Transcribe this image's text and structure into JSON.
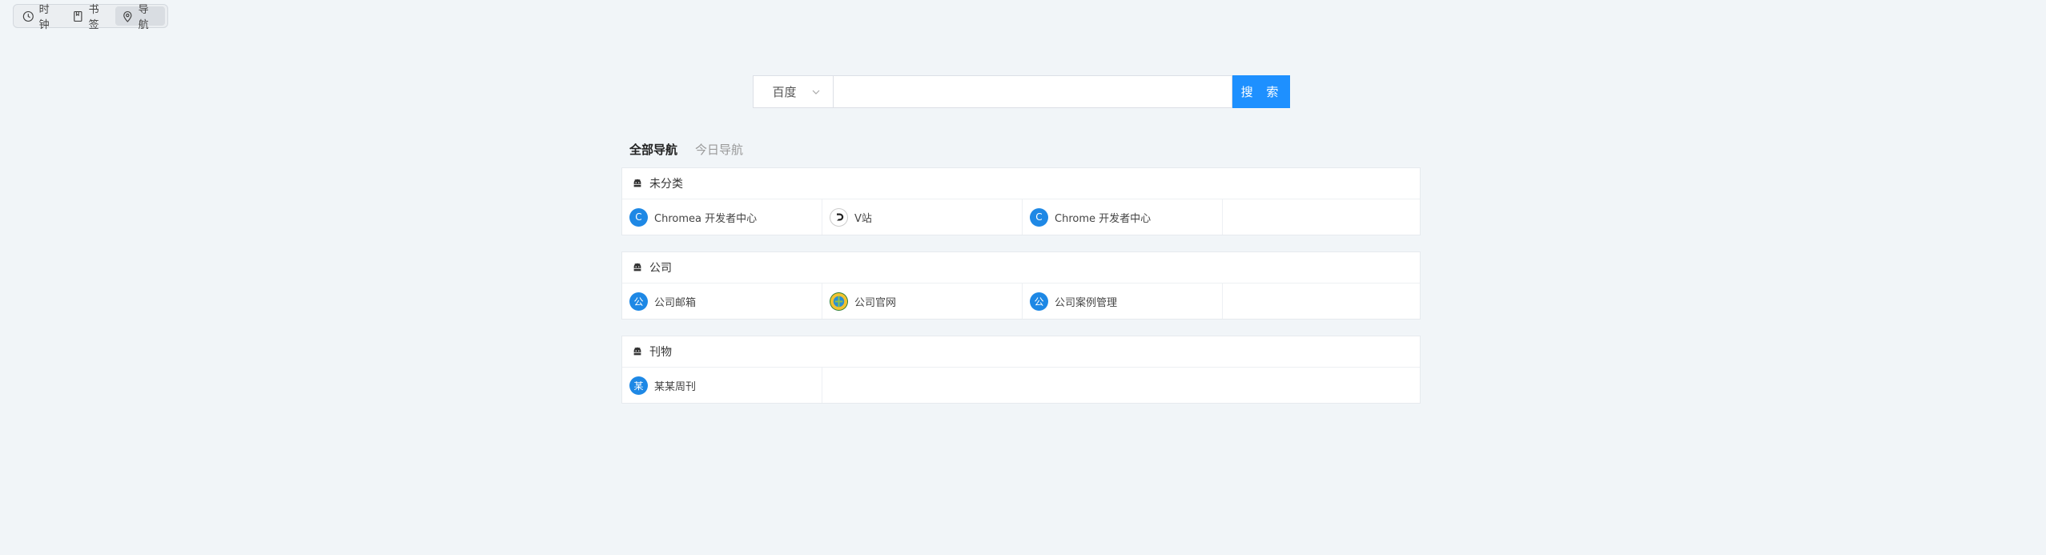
{
  "switcher": {
    "items": [
      {
        "label": "时钟",
        "icon": "clock-icon"
      },
      {
        "label": "书签",
        "icon": "bookmark-icon"
      },
      {
        "label": "导航",
        "icon": "location-pin-icon"
      }
    ]
  },
  "search": {
    "engine": "百度",
    "query": "",
    "button": "搜 索"
  },
  "tabs": [
    {
      "label": "全部导航"
    },
    {
      "label": "今日导航"
    }
  ],
  "groups": [
    {
      "title": "未分类",
      "items": [
        {
          "label": "Chromea 开发者中心",
          "badge": "C"
        },
        {
          "label": "V站",
          "badge": ""
        },
        {
          "label": "Chrome 开发者中心",
          "badge": "C"
        }
      ]
    },
    {
      "title": "公司",
      "items": [
        {
          "label": "公司邮箱",
          "badge": "公"
        },
        {
          "label": "公司官网",
          "badge": ""
        },
        {
          "label": "公司案例管理",
          "badge": "公"
        }
      ]
    },
    {
      "title": "刊物",
      "items": [
        {
          "label": "某某周刊",
          "badge": "某"
        }
      ]
    }
  ],
  "colors": {
    "accent": "#1e90ff",
    "background": "#f1f5f8",
    "badge": "#1e88e5"
  }
}
